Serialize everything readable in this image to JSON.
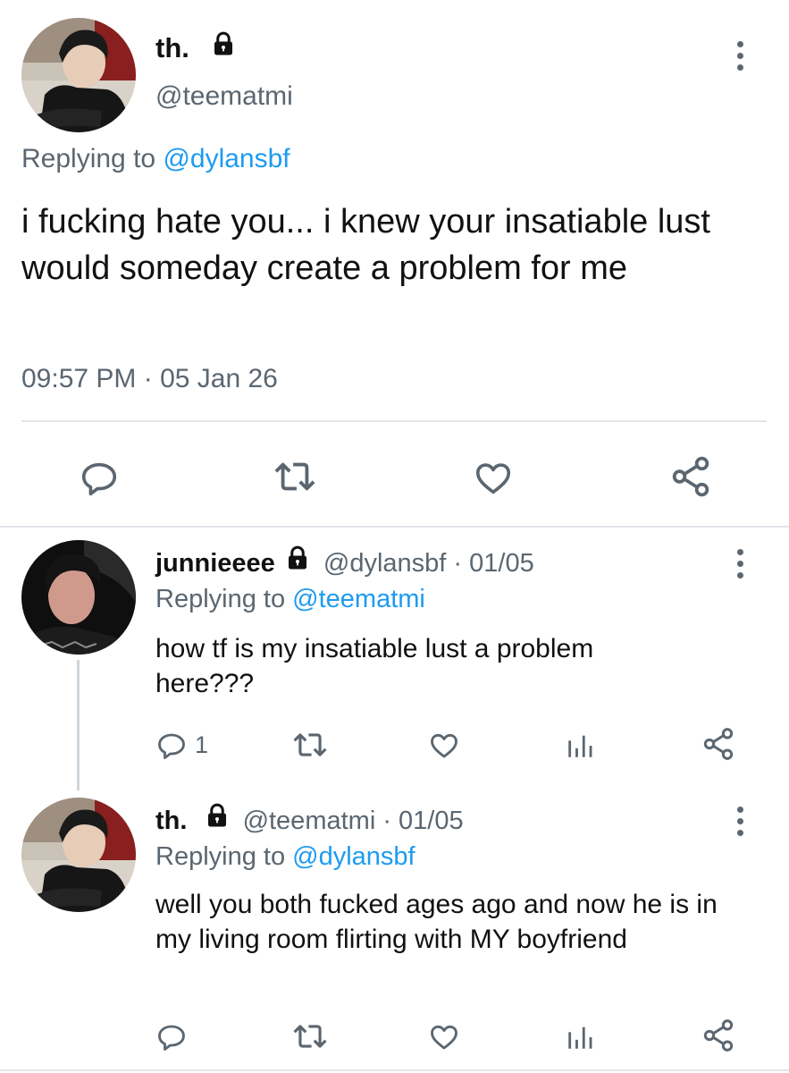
{
  "main_tweet": {
    "display_name": "th.",
    "handle": "@teematmi",
    "replying_prefix": "Replying to",
    "replying_handle": "@dylansbf",
    "text": "i fucking hate you... i knew your insatiable lust would someday create a problem for me",
    "timestamp": "09:57 PM · 05 Jan 26",
    "actions": [
      "reply-icon",
      "retweet-icon",
      "like-icon",
      "share-icon"
    ]
  },
  "replies": [
    {
      "display_name": "junnieeee",
      "handle": "@dylansbf",
      "date": "· 01/05",
      "replying_prefix": "Replying to",
      "replying_handle": "@teematmi",
      "text": "how tf is my insatiable lust a problem here???",
      "reply_count": "1",
      "actions": [
        "reply-icon",
        "retweet-icon",
        "like-icon",
        "analytics-icon",
        "share-icon"
      ]
    },
    {
      "display_name": "th.",
      "handle": "@teematmi",
      "date": "· 01/05",
      "replying_prefix": "Replying to",
      "replying_handle": "@dylansbf",
      "text": "well you both fucked ages ago and now he is in my living room flirting with MY boyfriend",
      "reply_count": "",
      "actions": [
        "reply-icon",
        "retweet-icon",
        "like-icon",
        "analytics-icon",
        "share-icon"
      ]
    }
  ],
  "colors": {
    "link": "#1d9bf0",
    "muted": "#5b6670",
    "divider": "#e2e6ea"
  }
}
